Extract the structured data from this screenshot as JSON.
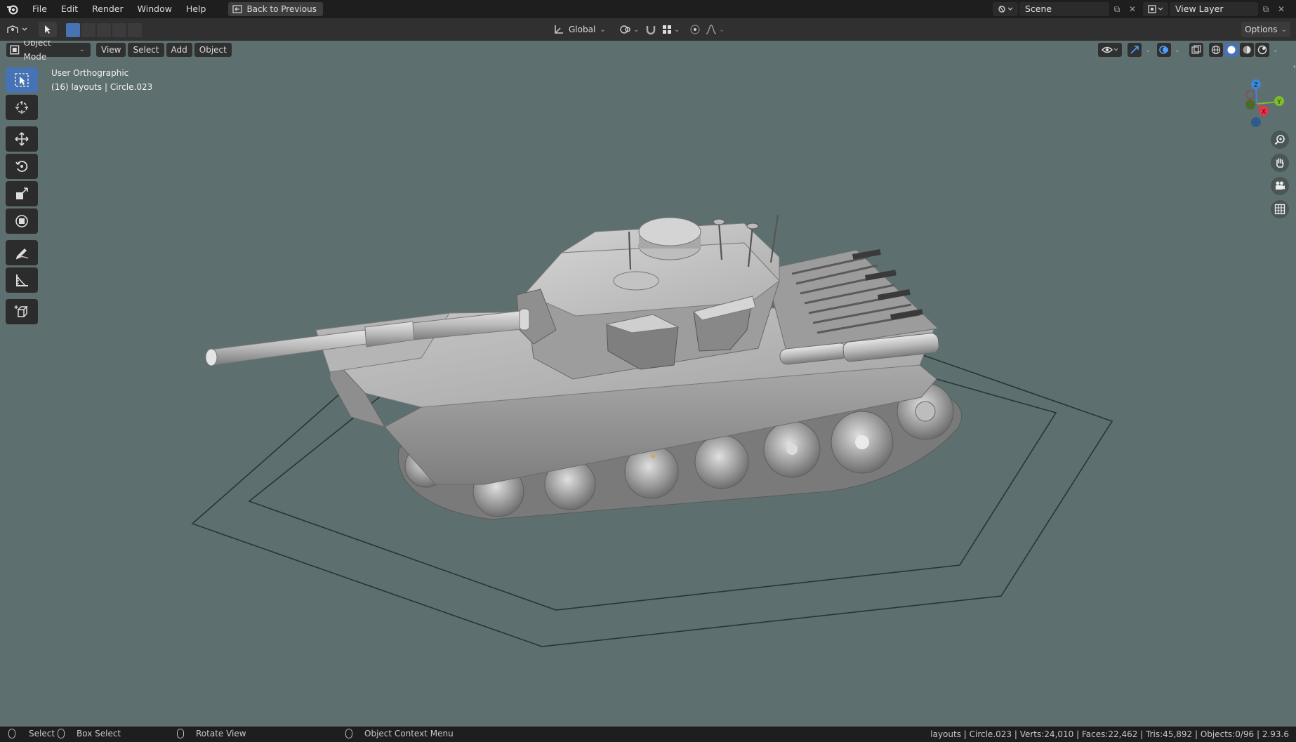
{
  "topbar": {
    "menus": [
      "File",
      "Edit",
      "Render",
      "Window",
      "Help"
    ],
    "back_button": "Back to Previous",
    "scene": "Scene",
    "view_layer": "View Layer"
  },
  "toolheader": {
    "orientation": "Global",
    "options": "Options"
  },
  "viewport": {
    "mode": "Object Mode",
    "menus": [
      "View",
      "Select",
      "Add",
      "Object"
    ],
    "view_name": "User Orthographic",
    "collection_info": "(16) layouts | Circle.023",
    "background_color": "#5d6f6f",
    "gizmo": {
      "z": "Z",
      "y": "Y",
      "x": "X"
    }
  },
  "tools": [
    "select-box",
    "cursor",
    "move",
    "rotate",
    "scale",
    "transform",
    "annotate",
    "measure",
    "add-cube"
  ],
  "statusbar": {
    "select": "Select",
    "box_select": "Box Select",
    "rotate_view": "Rotate View",
    "context_menu": "Object Context Menu",
    "stats": "layouts | Circle.023 | Verts:24,010 | Faces:22,462 | Tris:45,892 | Objects:0/96 | 2.93.6"
  },
  "colors": {
    "accent": "#4772b3",
    "x_axis": "#e8354a",
    "y_axis": "#7fbe2a",
    "z_axis": "#3b87d8"
  }
}
